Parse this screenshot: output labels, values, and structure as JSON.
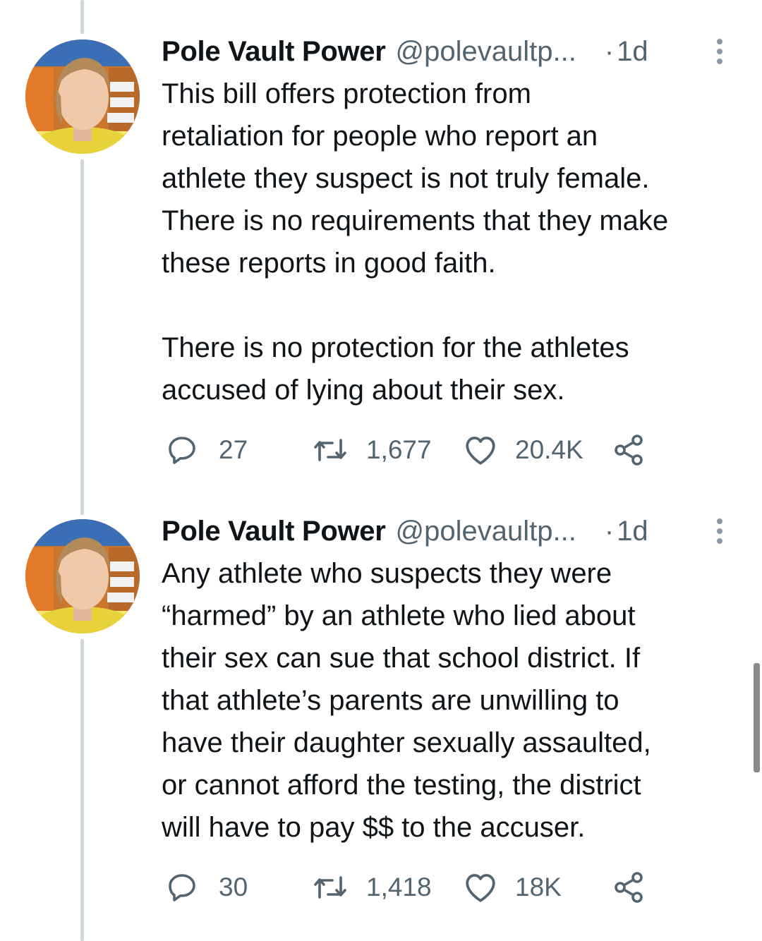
{
  "tweets": [
    {
      "author_name": "Pole Vault Power",
      "author_handle": "@polevaultp...",
      "separator": "·",
      "time": "1d",
      "text": "This bill offers protection from\nretaliation for people who report an\nathlete they suspect is not truly female.\nThere is no requirements that they make\nthese reports in good faith.\n\nThere is no protection for the athletes\naccused of lying about their sex.",
      "replies": "27",
      "retweets": "1,677",
      "likes": "20.4K"
    },
    {
      "author_name": "Pole Vault Power",
      "author_handle": "@polevaultp...",
      "separator": "·",
      "time": "1d",
      "text": "Any athlete who suspects they were\n“harmed” by an athlete who lied about\ntheir sex can sue that school district. If\nthat athlete’s parents are unwilling to\nhave their daughter sexually assaulted,\nor cannot afford the testing, the district\nwill have to pay $$ to the accuser.",
      "replies": "30",
      "retweets": "1,418",
      "likes": "18K"
    }
  ],
  "icons": {
    "reply": "reply-icon",
    "retweet": "retweet-icon",
    "like": "heart-icon",
    "share": "share-icon",
    "more": "more-options-icon"
  },
  "colors": {
    "text": "#0f1419",
    "secondary": "#536471",
    "thread_line": "#cfd9de",
    "background": "#ffffff"
  }
}
